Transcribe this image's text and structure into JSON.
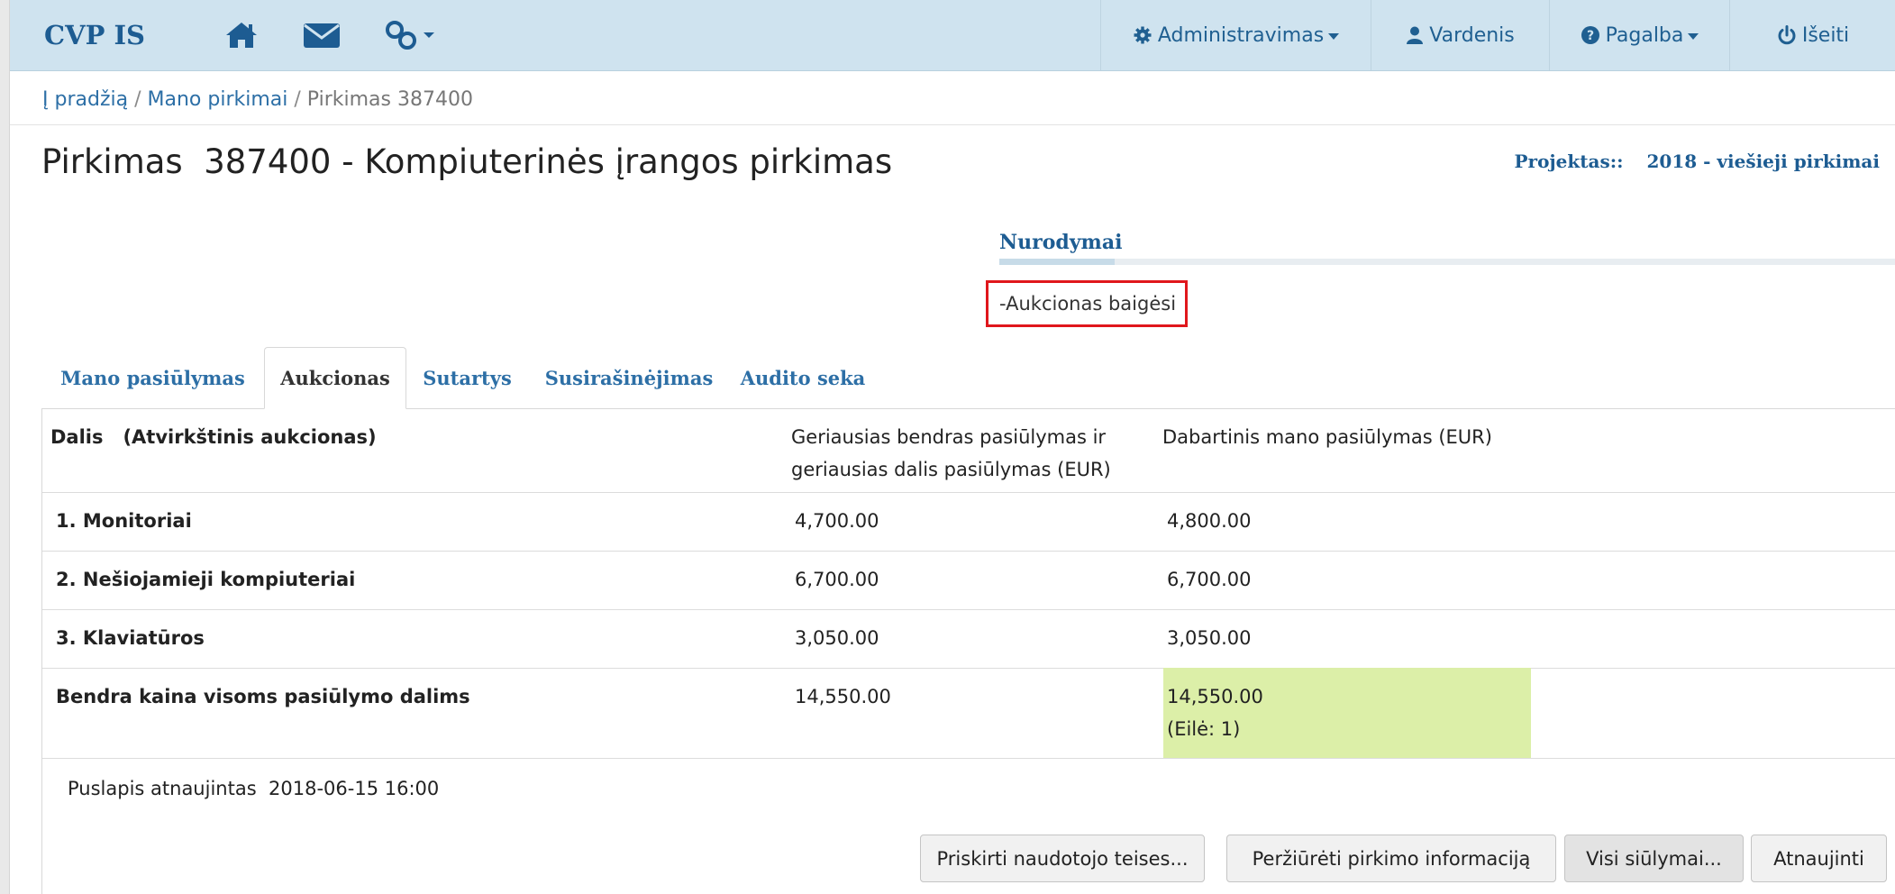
{
  "navbar": {
    "brand": "CVP IS",
    "icons": [
      "home-icon",
      "envelope-icon",
      "link-icon"
    ],
    "admin_label": "Administravimas",
    "user_label": "Vardenis",
    "help_label": "Pagalba",
    "logout_label": "Išeiti"
  },
  "breadcrumb": {
    "home": "Į pradžią",
    "my_purchases": "Mano pirkimai",
    "current": "Pirkimas 387400"
  },
  "title": "Pirkimas  387400 - Kompiuterinės įrangos pirkimas",
  "project": {
    "label": "Projektas::",
    "value": "2018 - viešieji pirkimai"
  },
  "instructions": {
    "heading": "Nurodymai",
    "message": "-Aukcionas baigėsi"
  },
  "tabs": [
    "Mano pasiūlymas",
    "Aukcionas",
    "Sutartys",
    "Susirašinėjimas",
    "Audito seka"
  ],
  "active_tab": "Aukcionas",
  "table": {
    "headers": {
      "part": "Dalis",
      "auction_type": "(Atvirkštinis aukcionas)",
      "best_line1": "Geriausias bendras pasiūlymas ir",
      "best_line2": "geriausias dalis pasiūlymas (EUR)",
      "mine": "Dabartinis mano pasiūlymas (EUR)"
    },
    "rows": [
      {
        "name": "1. Monitoriai",
        "best": "4,700.00",
        "mine": "4,800.00"
      },
      {
        "name": "2. Nešiojamieji kompiuteriai",
        "best": "6,700.00",
        "mine": "6,700.00"
      },
      {
        "name": "3. Klaviatūros",
        "best": "3,050.00",
        "mine": "3,050.00"
      }
    ],
    "total": {
      "name": "Bendra kaina visoms pasiūlymo dalims",
      "best": "14,550.00",
      "mine": "14,550.00",
      "rank": "(Eilė: 1)"
    }
  },
  "updated": {
    "label": "Puslapis atnaujintas",
    "value": "2018-06-15 16:00"
  },
  "buttons": {
    "assign_rights": "Priskirti naudotojo teises...",
    "view_info": "Peržiūrėti pirkimo informaciją",
    "all_bids": "Visi siūlymai...",
    "refresh": "Atnaujinti"
  },
  "colors": {
    "brand": "#1d5c92",
    "navbar_bg": "#cfe3ef",
    "highlight": "#dcefa8",
    "alert_border": "#e0171c"
  }
}
